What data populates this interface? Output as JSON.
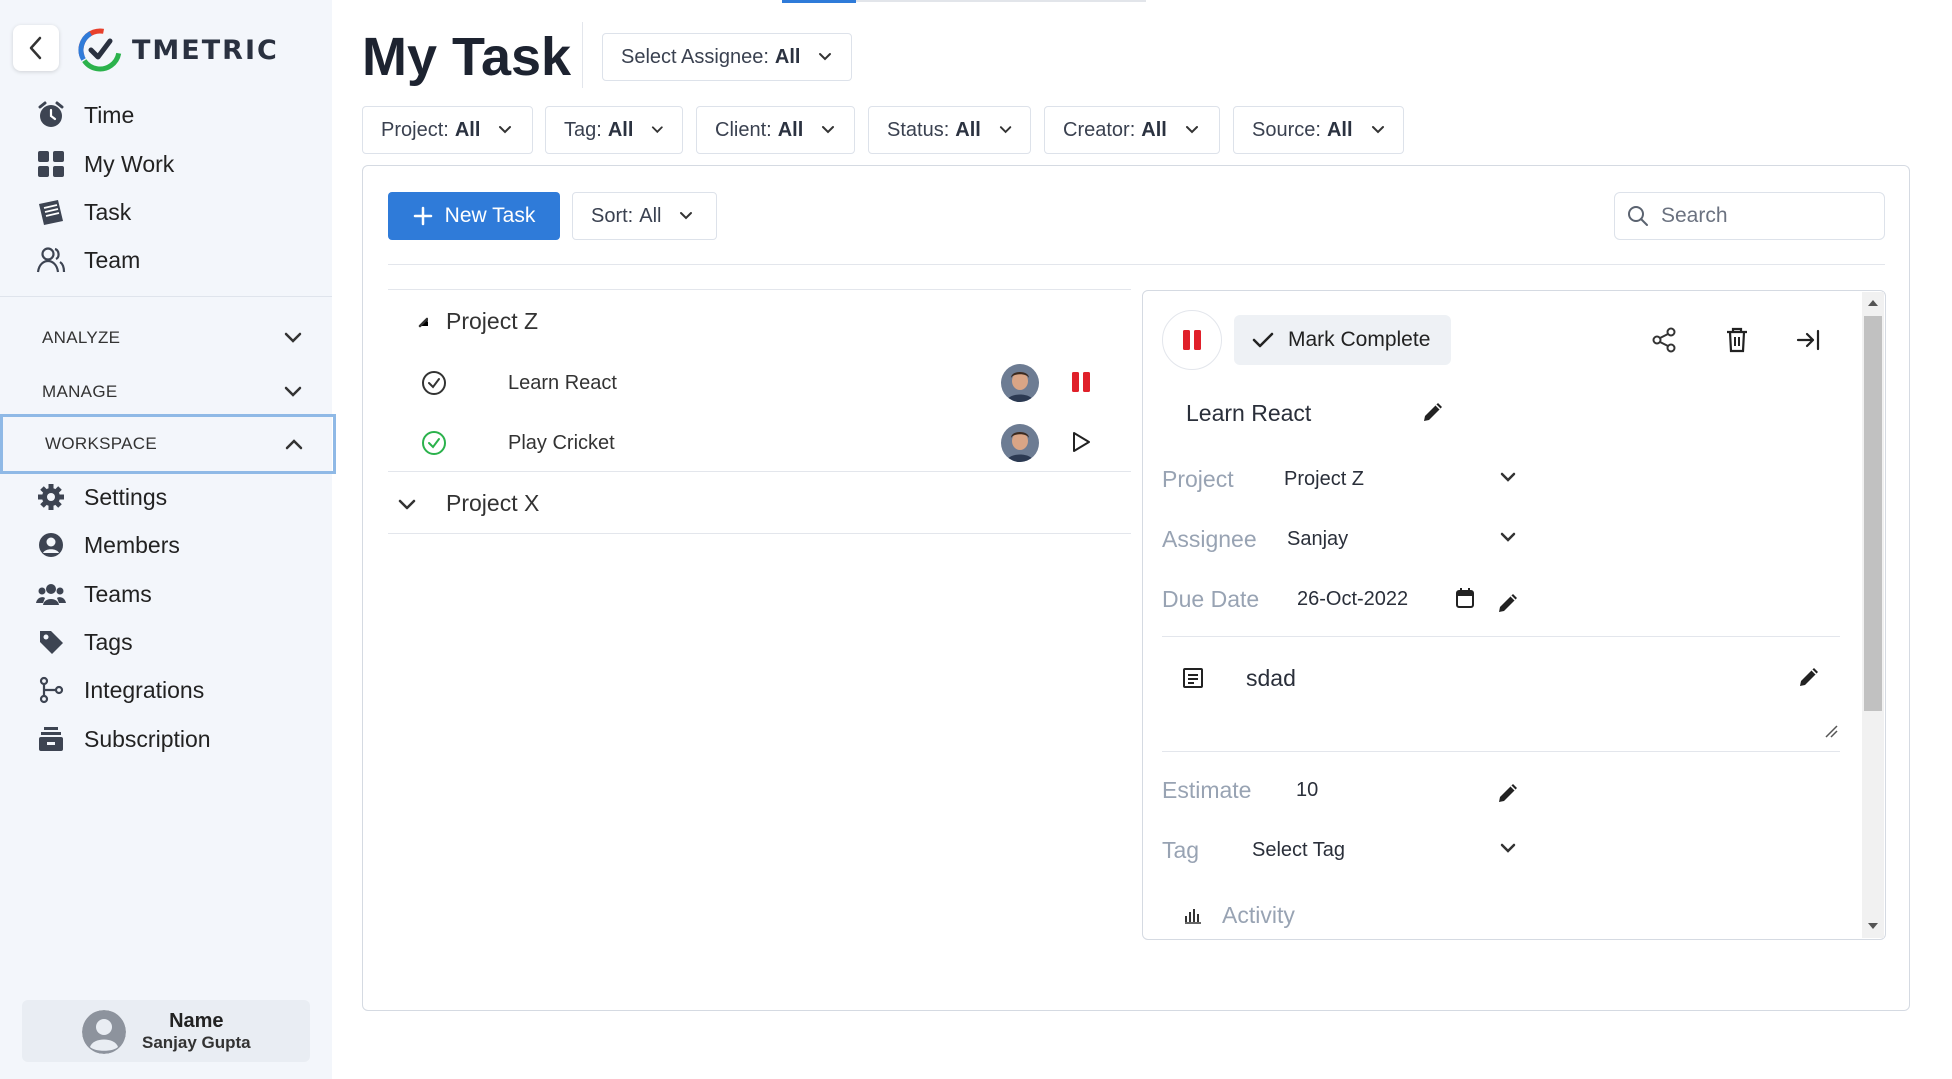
{
  "app": {
    "brand": "TMETRIC"
  },
  "sidebar": {
    "nav": [
      {
        "label": "Time",
        "icon": "alarm-clock-icon"
      },
      {
        "label": "My Work",
        "icon": "grid-icon"
      },
      {
        "label": "Task",
        "icon": "notepad-icon"
      },
      {
        "label": "Team",
        "icon": "people-icon"
      }
    ],
    "sections": [
      {
        "label": "ANALYZE",
        "expanded": false
      },
      {
        "label": "MANAGE",
        "expanded": false
      },
      {
        "label": "WORKSPACE",
        "expanded": true
      }
    ],
    "workspace_items": [
      {
        "label": "Settings",
        "icon": "gear-icon"
      },
      {
        "label": "Members",
        "icon": "user-circle-icon"
      },
      {
        "label": "Teams",
        "icon": "group-icon"
      },
      {
        "label": "Tags",
        "icon": "tag-icon"
      },
      {
        "label": "Integrations",
        "icon": "branch-icon"
      },
      {
        "label": "Subscription",
        "icon": "stack-icon"
      }
    ],
    "user": {
      "label": "Name",
      "name": "Sanjay Gupta"
    }
  },
  "header": {
    "title": "My Task",
    "assignee": {
      "label": "Select Assignee:",
      "value": "All"
    }
  },
  "filters": [
    {
      "label": "Project:",
      "value": "All"
    },
    {
      "label": "Tag:",
      "value": "All"
    },
    {
      "label": "Client:",
      "value": "All"
    },
    {
      "label": "Status:",
      "value": "All"
    },
    {
      "label": "Creator:",
      "value": "All"
    },
    {
      "label": "Source:",
      "value": "All"
    }
  ],
  "toolbar": {
    "new_task": "New Task",
    "sort": {
      "label": "Sort:",
      "value": "All"
    },
    "search_placeholder": "Search"
  },
  "groups": [
    {
      "name": "Project Z",
      "expanded": true,
      "tasks": [
        {
          "name": "Learn React",
          "status": "running",
          "action": "pause"
        },
        {
          "name": "Play Cricket",
          "status": "completed",
          "action": "play"
        }
      ]
    },
    {
      "name": "Project X",
      "expanded": false,
      "tasks": []
    }
  ],
  "detail": {
    "mark_complete": "Mark Complete",
    "task_name": "Learn React",
    "project": {
      "label": "Project",
      "value": "Project Z"
    },
    "assignee": {
      "label": "Assignee",
      "value": "Sanjay"
    },
    "due_date": {
      "label": "Due Date",
      "value": "26-Oct-2022"
    },
    "description": "sdad",
    "estimate": {
      "label": "Estimate",
      "value": "10"
    },
    "tag": {
      "label": "Tag",
      "value": "Select Tag"
    },
    "activity": "Activity"
  },
  "colors": {
    "accent": "#2f7bd9",
    "stop": "#e0202a",
    "success": "#2bb24c"
  }
}
